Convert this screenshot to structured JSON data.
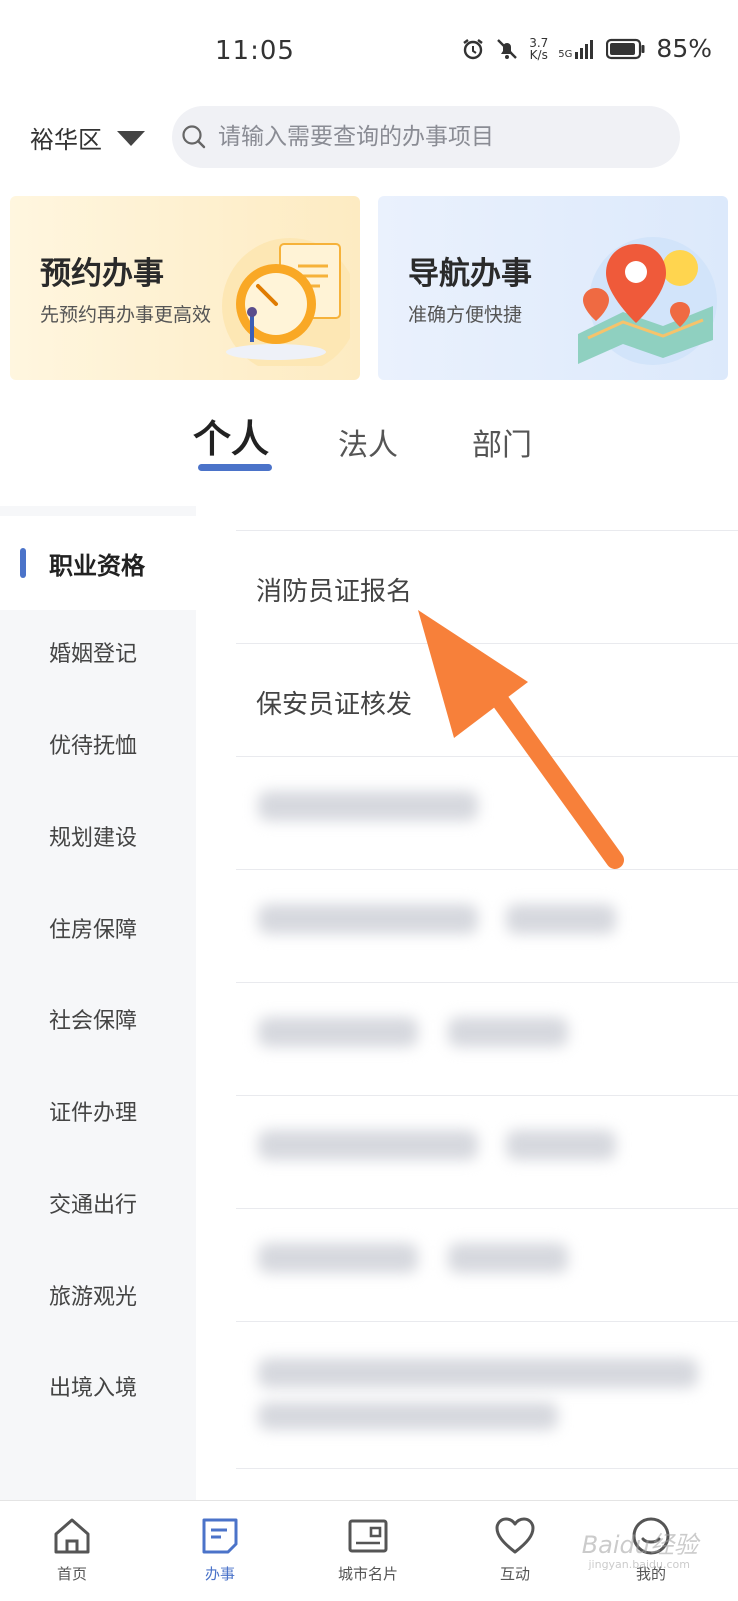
{
  "status_bar": {
    "time": "11:05",
    "speed_value": "3.7",
    "speed_unit": "K/s",
    "network": "5G",
    "battery": "85%"
  },
  "header": {
    "region": "裕华区",
    "search_placeholder": "请输入需要查询的办事项目"
  },
  "banners": [
    {
      "title": "预约办事",
      "subtitle": "先预约再办事更高效"
    },
    {
      "title": "导航办事",
      "subtitle": "准确方便快捷"
    }
  ],
  "tabs": [
    {
      "label": "个人",
      "active": true
    },
    {
      "label": "法人",
      "active": false
    },
    {
      "label": "部门",
      "active": false
    }
  ],
  "sidebar": {
    "items": [
      {
        "label": "职业资格",
        "active": true
      },
      {
        "label": "婚姻登记"
      },
      {
        "label": "优待抚恤"
      },
      {
        "label": "规划建设"
      },
      {
        "label": "住房保障"
      },
      {
        "label": "社会保障"
      },
      {
        "label": "证件办理"
      },
      {
        "label": "交通出行"
      },
      {
        "label": "旅游观光"
      },
      {
        "label": "出境入境"
      }
    ]
  },
  "services": [
    {
      "label": "消防员证报名"
    },
    {
      "label": "保安员证核发"
    }
  ],
  "bottom_nav": [
    {
      "label": "首页",
      "icon": "home-icon"
    },
    {
      "label": "办事",
      "icon": "document-icon",
      "active": true
    },
    {
      "label": "城市名片",
      "icon": "card-icon"
    },
    {
      "label": "互动",
      "icon": "heart-icon"
    },
    {
      "label": "我的",
      "icon": "user-icon"
    }
  ],
  "colors": {
    "accent": "#4b73c9",
    "arrow": "#f7803a"
  },
  "watermark": {
    "text": "Baidu经验",
    "sub": "jingyan.baidu.com"
  }
}
